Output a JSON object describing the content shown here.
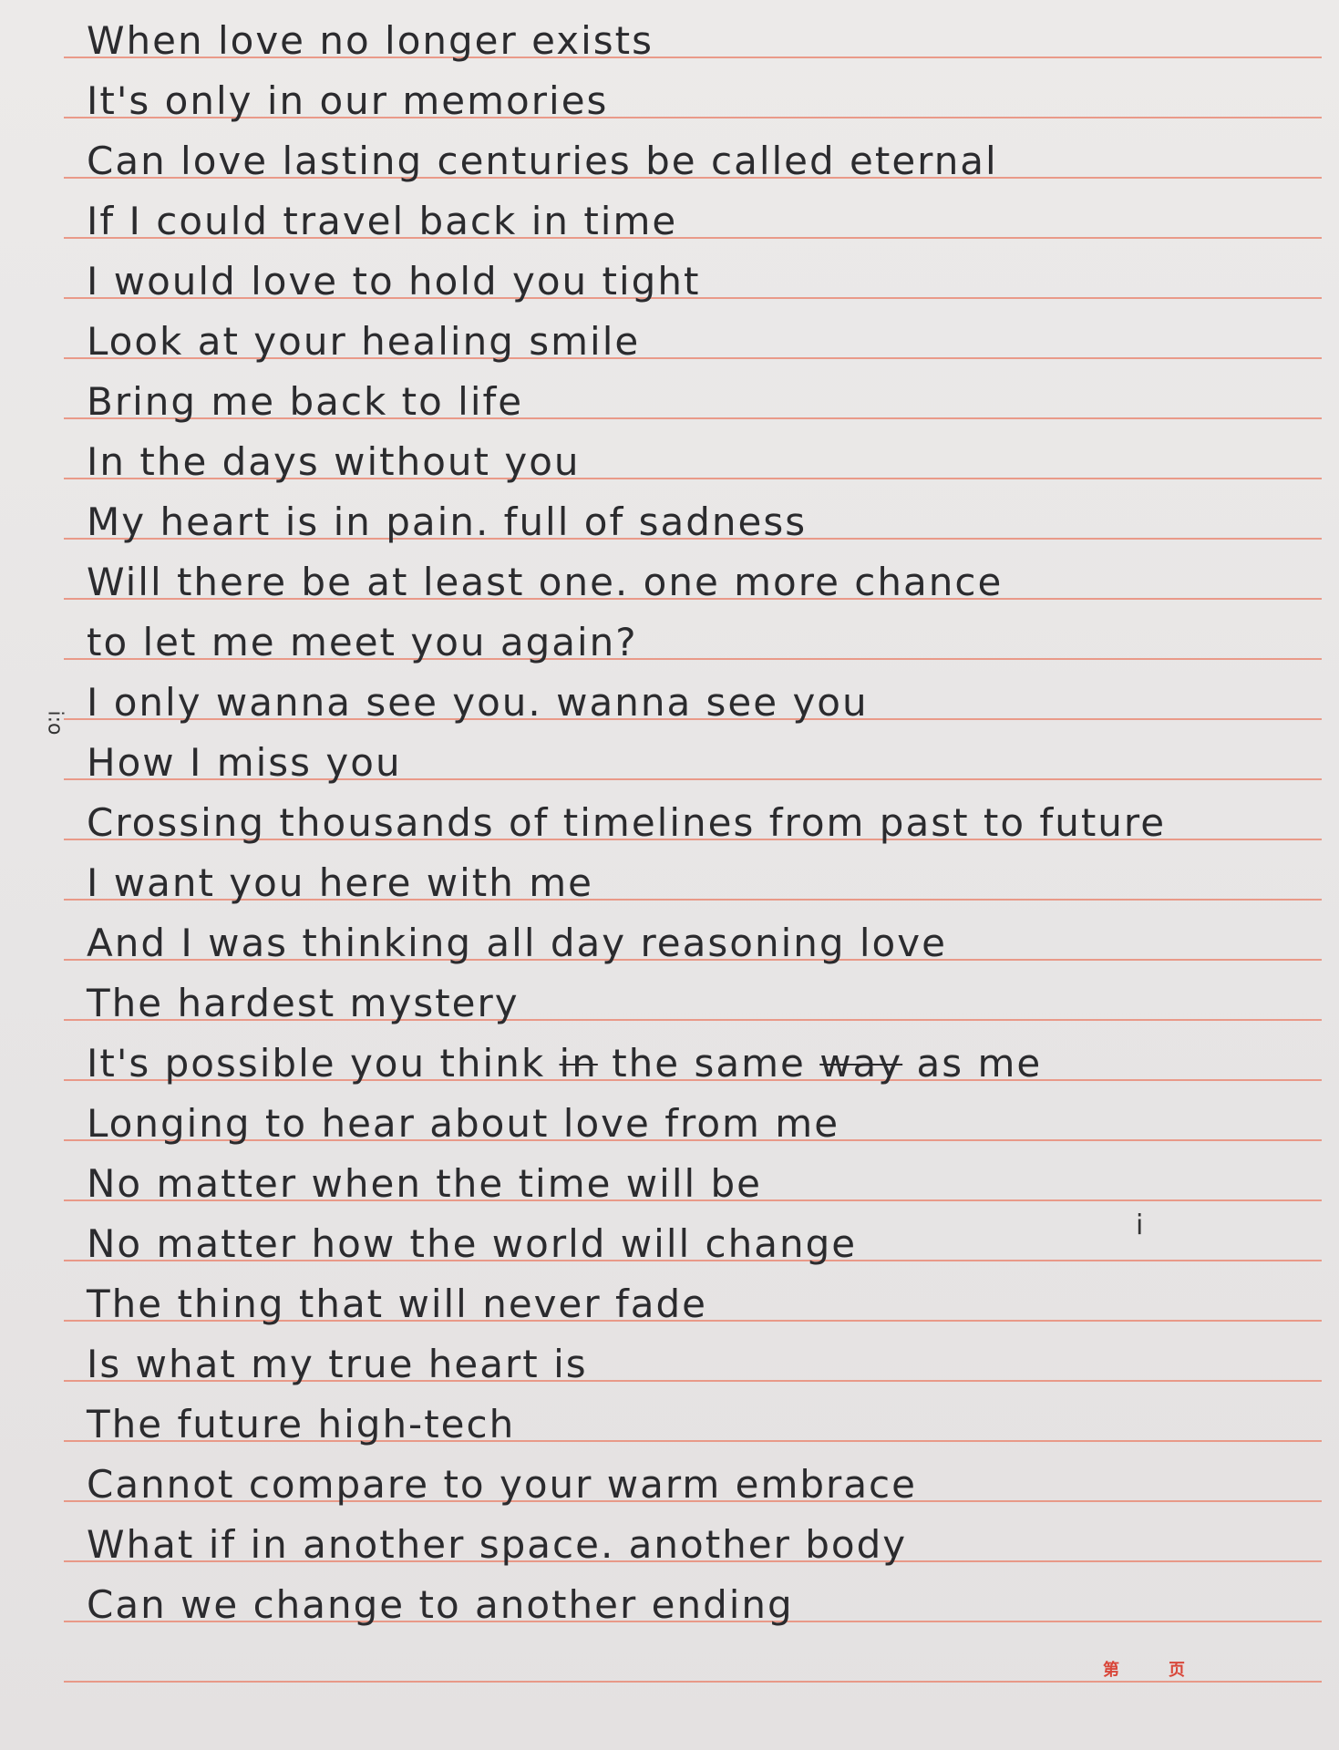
{
  "lines": [
    "When love no longer exists",
    "It's only in our memories",
    "Can love lasting centuries be called eternal",
    "If I could travel back in time",
    "I would love to hold you tight",
    "Look at your healing smile",
    "Bring me back to life",
    "In the days without you",
    "My heart is in pain. full of sadness",
    "Will there be at least one. one more chance",
    "to let me meet you again?",
    "I only wanna see you. wanna see you",
    "How I miss you",
    "Crossing thousands of timelines from past to future",
    "I want you here with me",
    "And I was thinking all day reasoning love",
    "The hardest mystery",
    "Longing to hear about love from me",
    "No matter when the time will be",
    "No matter how the world will change",
    "The thing that will never fade",
    "Is what my true heart is",
    "The future high-tech",
    "Cannot compare to your warm embrace",
    "What if in another space. another body",
    "Can we change to another ending"
  ],
  "line18": {
    "a": "It's possible you think",
    "struck1": "in",
    "b": "the same",
    "struck2": "way",
    "c": "as me"
  },
  "margin_marks": {
    "left": "i:o",
    "right": "i"
  },
  "footer": {
    "page_prefix": "第",
    "page_suffix": "页"
  }
}
